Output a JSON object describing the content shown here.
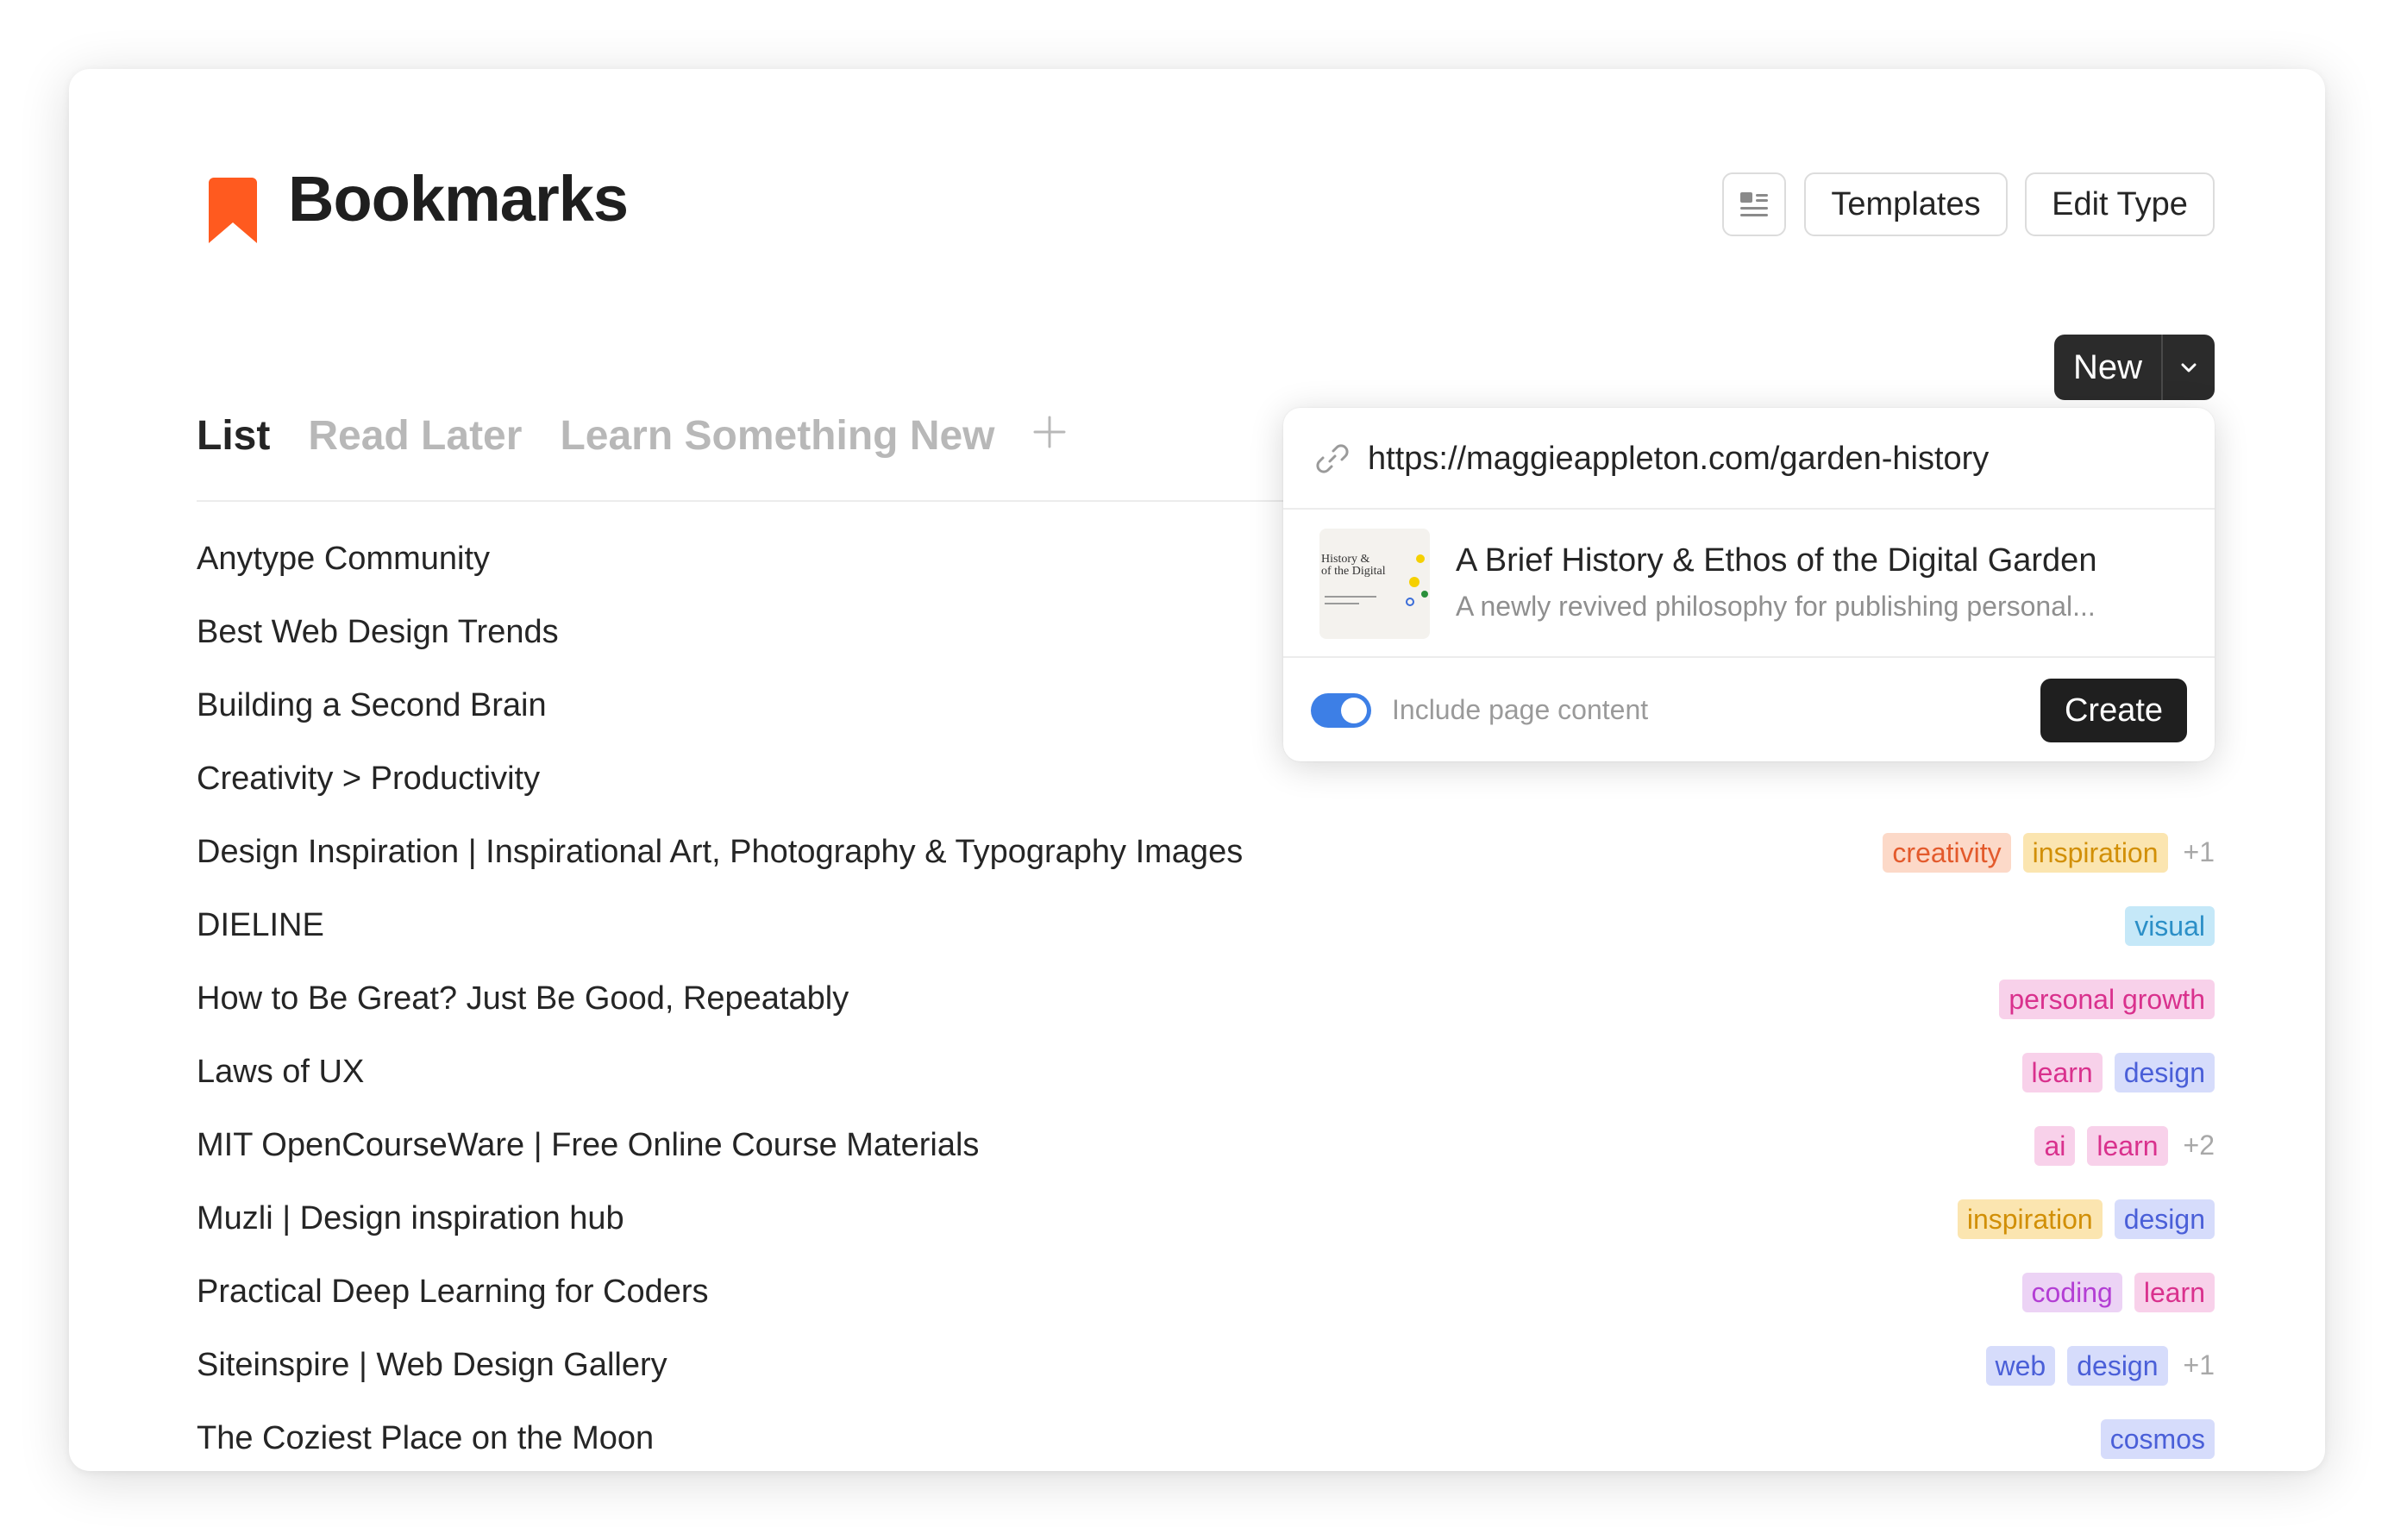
{
  "header": {
    "title": "Bookmarks",
    "icon": "bookmark-icon",
    "icon_color": "#ff5a1f",
    "buttons": {
      "templates": "Templates",
      "edit_type": "Edit Type"
    }
  },
  "tabs": [
    {
      "label": "List",
      "active": true
    },
    {
      "label": "Read Later",
      "active": false
    },
    {
      "label": "Learn Something New",
      "active": false
    }
  ],
  "toolbar": {
    "icons": [
      "search-icon",
      "filter-icon",
      "sort-icon",
      "settings-sliders-icon"
    ],
    "new_label": "New"
  },
  "bookmarks": [
    {
      "title": "Anytype Community",
      "tags": []
    },
    {
      "title": "Best Web Design Trends",
      "tags": []
    },
    {
      "title": "Building a Second Brain",
      "tags": []
    },
    {
      "title": "Creativity > Productivity",
      "tags": []
    },
    {
      "title": "Design Inspiration | Inspirational Art, Photography & Typography Images",
      "tags": [
        "creativity",
        "inspiration"
      ],
      "more": "+1"
    },
    {
      "title": "DIELINE",
      "tags": [
        "visual"
      ]
    },
    {
      "title": "How to Be Great? Just Be Good, Repeatably",
      "tags": [
        "personal growth"
      ]
    },
    {
      "title": "Laws of UX",
      "tags": [
        "learn",
        "design"
      ]
    },
    {
      "title": "MIT OpenCourseWare | Free Online Course Materials",
      "tags": [
        "ai",
        "learn"
      ],
      "more": "+2"
    },
    {
      "title": "Muzli | Design inspiration hub",
      "tags": [
        "inspiration",
        "design"
      ]
    },
    {
      "title": "Practical Deep Learning for Coders",
      "tags": [
        "coding",
        "learn"
      ]
    },
    {
      "title": "Siteinspire | Web Design Gallery",
      "tags": [
        "web",
        "design"
      ],
      "more": "+1"
    },
    {
      "title": "The Coziest Place on the Moon",
      "tags": [
        "cosmos"
      ]
    }
  ],
  "tag_colors": {
    "creativity": "#e35a2c",
    "inspiration": "#d18f06",
    "visual": "#2b8fc7",
    "personal growth": "#d9318d",
    "learn": "#d9318d",
    "design": "#4a5fd8",
    "ai": "#d9318d",
    "coding": "#b33ed4",
    "web": "#4a5fd8",
    "cosmos": "#4a5fd8"
  },
  "popup": {
    "url_value": "https://maggieappleton.com/garden-history",
    "result": {
      "title": "A Brief History & Ethos of the Digital Garden",
      "description": "A newly revived philosophy for publishing personal...",
      "thumb_text_line1": "History &",
      "thumb_text_line2": "of the Digital"
    },
    "include_content_label": "Include page content",
    "include_content_on": true,
    "create_label": "Create"
  }
}
